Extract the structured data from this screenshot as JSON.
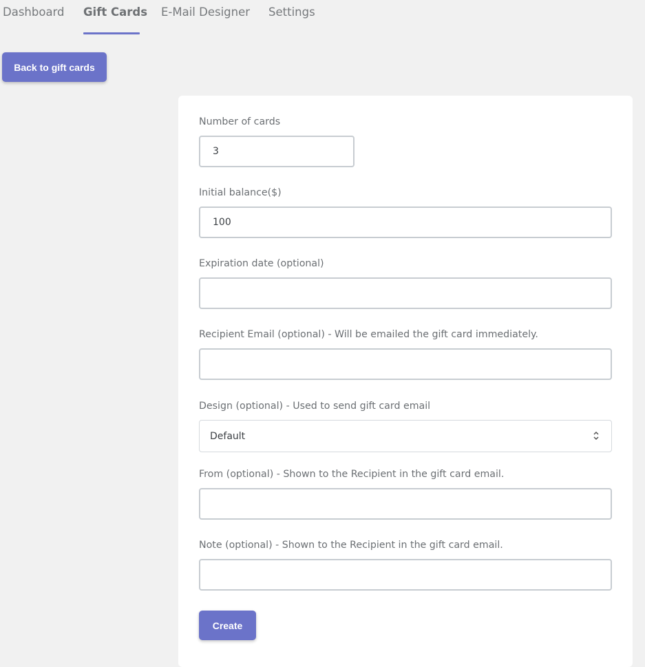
{
  "tabs": [
    {
      "label": "Dashboard"
    },
    {
      "label": "Gift Cards"
    },
    {
      "label": "E-Mail Designer"
    },
    {
      "label": "Settings"
    }
  ],
  "back_button": {
    "label": "Back to gift cards"
  },
  "form": {
    "number_of_cards": {
      "label": "Number of cards",
      "value": "3"
    },
    "initial_balance": {
      "label": "Initial balance($)",
      "value": "100"
    },
    "expiration_date": {
      "label": "Expiration date (optional)",
      "value": ""
    },
    "recipient_email": {
      "label": "Recipient Email (optional) - Will be emailed the gift card immediately.",
      "value": ""
    },
    "design": {
      "label": "Design (optional) - Used to send gift card email",
      "selected": "Default"
    },
    "from": {
      "label": "From (optional) - Shown to the Recipient in the gift card email.",
      "value": ""
    },
    "note": {
      "label": "Note (optional) - Shown to the Recipient in the gift card email.",
      "value": ""
    },
    "create_label": "Create"
  },
  "colors": {
    "accent": "#6b73c9",
    "background": "#f1f1f1",
    "card": "#ffffff"
  }
}
